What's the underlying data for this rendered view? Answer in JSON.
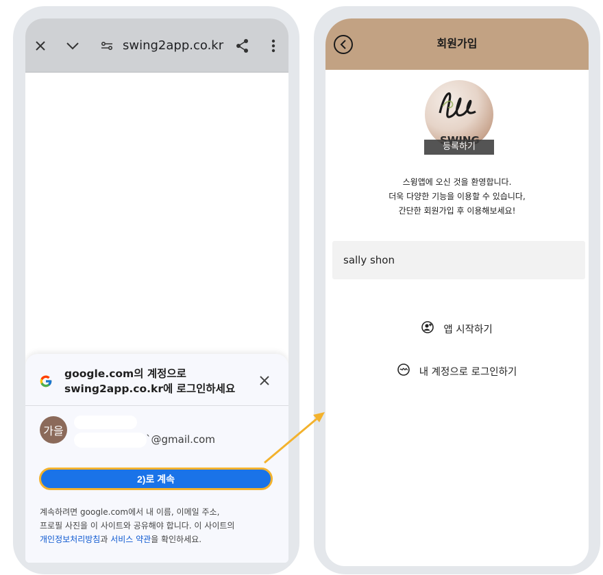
{
  "browser": {
    "url": "swing2app.co.kr",
    "icons": [
      "close-icon",
      "chevron-down-icon",
      "site-settings-icon",
      "share-icon",
      "more-vert-icon"
    ]
  },
  "google_sheet": {
    "title_line1": "google.com의 계정으로",
    "title_line2": "swing2app.co.kr에 로그인하세요",
    "avatar_text": "가을",
    "email": "`@gmail.com",
    "continue_label": "2)로 계속",
    "legal_text_1": "계속하려면 google.com에서 내 이름, 이메일 주소,",
    "legal_text_2": "프로필 사진을 이 사이트와 공유해야 합니다. 이 사이트의",
    "privacy_link": "개인정보처리방침",
    "legal_and": "과 ",
    "terms_link": "서비스 약관",
    "legal_end": "을 확인하세요."
  },
  "app": {
    "title": "회원가입",
    "profile_watermark": "SWING",
    "register_label": "등록하기",
    "welcome_line1": "스윙앱에 오신 것을 환영합니다.",
    "welcome_line2": "더욱 다양한 기능을 이용할 수 있습니다,",
    "welcome_line3": "간단한 회원가입 후 이용해보세요!",
    "name_value": "sally shon",
    "start_label": "앱 시작하기",
    "login_label": "내 계정으로 로그인하기"
  },
  "colors": {
    "header_tan": "#c2a283",
    "google_blue": "#1a73e8",
    "highlight_orange": "#f3b22d"
  }
}
